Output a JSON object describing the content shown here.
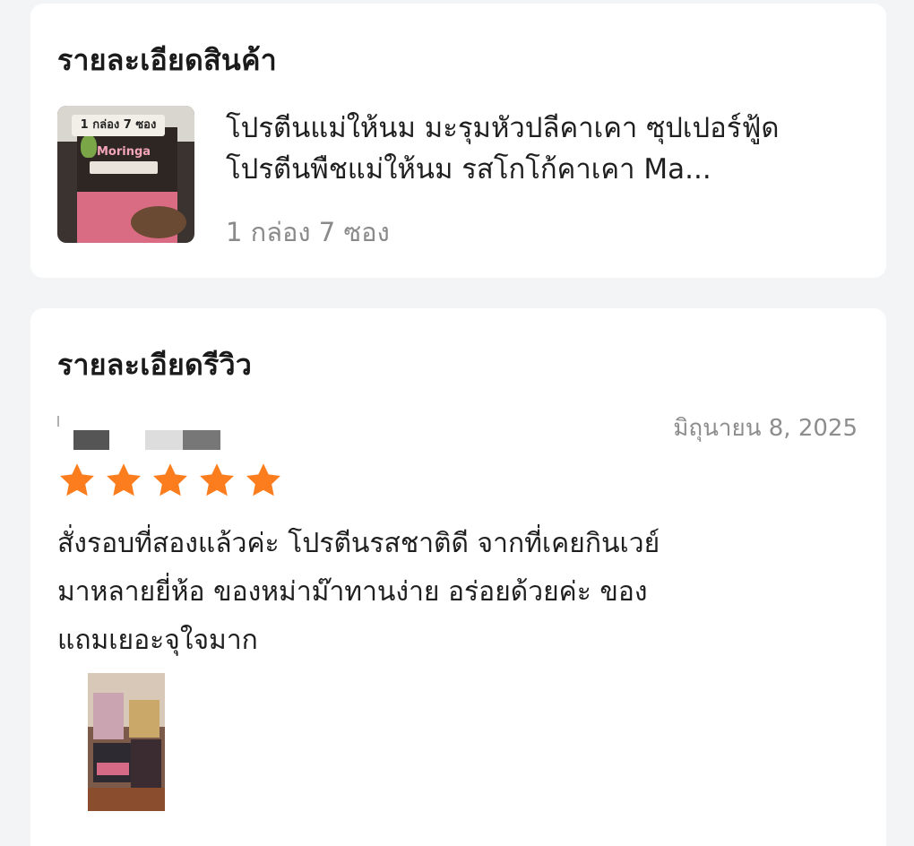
{
  "product_section": {
    "title": "รายละเอียดสินค้า",
    "thumbnail_label": "1 กล่อง 7 ซอง",
    "thumbnail_brand": "Moringa",
    "product_name": "โปรตีนแม่ให้นม มะรุมหัวปลีคาเคา ซุปเปอร์ฟู้ด โปรตีนพืชแม่ให้นม รสโกโก้คาเคา Ma...",
    "variant": "1 กล่อง 7 ซอง"
  },
  "review_section": {
    "title": "รายละเอียดรีวิว",
    "date": "มิถุนายน 8, 2025",
    "rating": 5,
    "max_rating": 5,
    "star_color": "#fb7d1e",
    "text": "สั่งรอบที่สองแล้วค่ะ  โปรตีนรสชาติดี  จากที่เคยกินเวย์\nมาหลายยี่ห้อ  ของหม่าม๊าทานง่าย อร่อยด้วยค่ะ  ของ\nแถมเยอะจุใจมาก"
  },
  "icons": {
    "star": "star-icon"
  }
}
